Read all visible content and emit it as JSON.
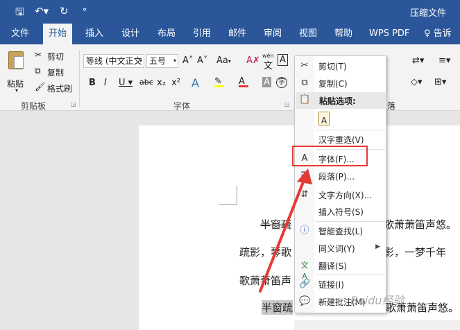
{
  "title_bar": {
    "doc_title": "压缩文件"
  },
  "ribbon_tabs": [
    {
      "label": "文件"
    },
    {
      "label": "开始"
    },
    {
      "label": "插入"
    },
    {
      "label": "设计"
    },
    {
      "label": "布局"
    },
    {
      "label": "引用"
    },
    {
      "label": "邮件"
    },
    {
      "label": "审阅"
    },
    {
      "label": "视图"
    },
    {
      "label": "帮助"
    },
    {
      "label": "WPS PDF"
    },
    {
      "label": "告诉我"
    }
  ],
  "clipboard": {
    "paste": "粘贴",
    "cut": "剪切",
    "copy": "复制",
    "format_painter": "格式刷",
    "group": "剪贴板"
  },
  "font": {
    "family": "等线 (中文正文",
    "size": "五号",
    "group": "字体",
    "aa": "Aa",
    "wen": "wén"
  },
  "context_menu": {
    "cut": "剪切(T)",
    "copy": "复制(C)",
    "paste_options": "粘贴选项:",
    "hanzi": "汉字重选(V)",
    "font": "字体(F)...",
    "paragraph": "段落(P)...",
    "text_direction": "文字方向(X)...",
    "insert_symbol": "插入符号(S)",
    "smart_lookup": "智能查找(L)",
    "synonym": "同义词(Y)",
    "translate": "翻译(S)",
    "link": "链接(I)",
    "new_comment": "新建批注(M)"
  },
  "document": {
    "line1_a": "半窗疏",
    "line1_b": "琴歌萧萧笛声悠。",
    "line2_a": "疏影，琴歌",
    "line2_b": "疏影，一梦千年",
    "line3": "歌萧萧笛声",
    "line4_a": "半窗疏",
    "line4_b": "歌萧萧笛声悠。"
  },
  "watermark": "Baidu经验",
  "colors": {
    "brand": "#2b579a",
    "highlight": "#e53935",
    "arrow": "#e53935"
  }
}
